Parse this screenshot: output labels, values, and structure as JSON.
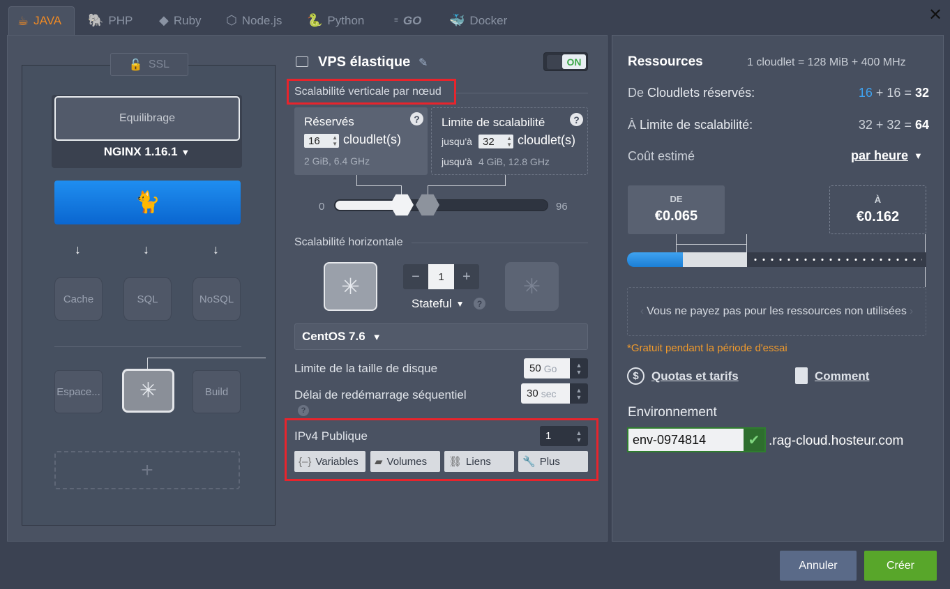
{
  "tabs": [
    {
      "label": "JAVA",
      "icon": "java-icon"
    },
    {
      "label": "PHP",
      "icon": "php-icon"
    },
    {
      "label": "Ruby",
      "icon": "ruby-icon"
    },
    {
      "label": "Node.js",
      "icon": "nodejs-icon"
    },
    {
      "label": "Python",
      "icon": "python-icon"
    },
    {
      "label": "GO",
      "icon": "go-icon"
    },
    {
      "label": "Docker",
      "icon": "docker-icon"
    }
  ],
  "topology": {
    "ssl_label": "SSL",
    "balancer_label": "Equilibrage",
    "balancer_version": "NGINX 1.16.1",
    "databases": [
      "Cache",
      "SQL",
      "NoSQL"
    ],
    "extra_nodes": {
      "left": "Espace...",
      "right": "Build"
    },
    "add_label": "+"
  },
  "vps": {
    "title": "VPS élastique",
    "toggle": "ON",
    "vertical_label": "Scalabilité verticale par nœud",
    "reserved": {
      "title": "Réservés",
      "value": "16",
      "unit": "cloudlet(s)",
      "specs": "2 GiB, 6.4 GHz"
    },
    "limit": {
      "title": "Limite de scalabilité",
      "prefix": "jusqu'à",
      "value": "32",
      "unit": "cloudlet(s)",
      "specs_prefix": "jusqu'à",
      "specs": "4 GiB, 12.8 GHz"
    },
    "slider": {
      "min": "0",
      "max": "96",
      "reserved": 16,
      "limit": 32
    },
    "horizontal_label": "Scalabilité horizontale",
    "node_count": "1",
    "mode": "Stateful",
    "os": "CentOS 7.6",
    "disk_label": "Limite de la taille de disque",
    "disk_value": "50",
    "disk_unit": "Go",
    "restart_label": "Délai de redémarrage séquentiel",
    "restart_value": "30",
    "restart_unit": "sec",
    "ipv4_label": "IPv4 Publique",
    "ipv4_value": "1",
    "tools": [
      "Variables",
      "Volumes",
      "Liens",
      "Plus"
    ]
  },
  "resources": {
    "title": "Ressources",
    "cloudlet_def": "1 cloudlet = 128 MiB + 400 MHz",
    "reserved_prefix": "De",
    "reserved_label": "Cloudlets réservés:",
    "reserved_a": "16",
    "reserved_b": "16",
    "reserved_total": "32",
    "limit_prefix": "À",
    "limit_label": "Limite de scalabilité:",
    "limit_a": "32",
    "limit_b": "32",
    "limit_total": "64",
    "cost_label": "Coût estimé",
    "cost_period": "par heure",
    "from_label": "DE",
    "from_price": "€0.065",
    "to_label": "À",
    "to_price": "€0.162",
    "info": "Vous ne payez pas pour les ressources non utilisées",
    "trial": "*Gratuit pendant la période d'essai",
    "quotas_link": "Quotas et tarifs",
    "how_link": "Comment",
    "env_label": "Environnement",
    "env_name": "env-0974814",
    "env_domain": ".rag-cloud.hosteur.com"
  },
  "footer": {
    "cancel": "Annuler",
    "create": "Créer"
  },
  "colors": {
    "accent_blue": "#1f8ef0",
    "accent_orange": "#f08a24",
    "create_green": "#58a62a",
    "highlight_red": "#e8242c"
  }
}
